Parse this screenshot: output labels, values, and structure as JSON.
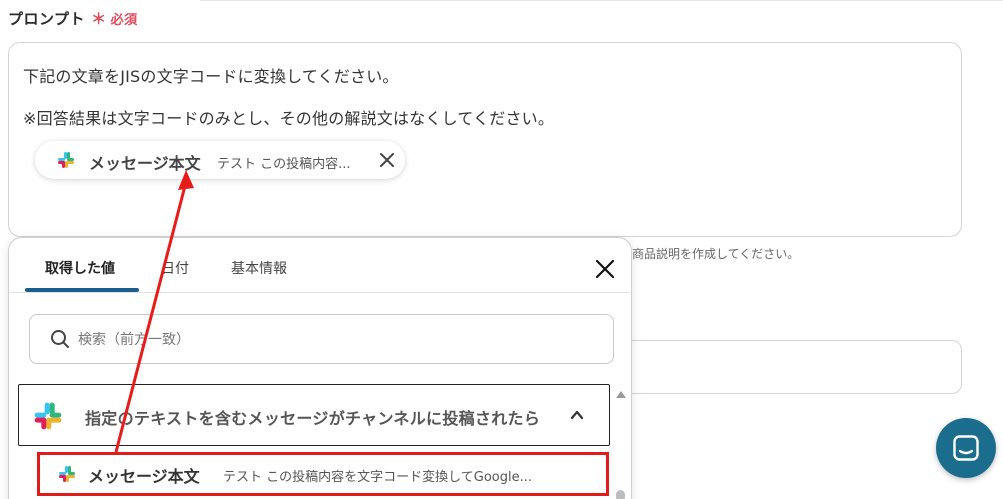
{
  "field": {
    "label": "プロンプト",
    "required_mark": "＊",
    "required_text": "必須"
  },
  "prompt": {
    "line1": "下記の文章をJISの文字コードに変換してください。",
    "line2": "※回答結果は文字コードのみとし、その他の解説文はなくしてください。",
    "chip": {
      "label": "メッセージ本文",
      "value": "テスト この投稿内容..."
    }
  },
  "helper_text": "商品説明を作成してください。",
  "popup": {
    "tabs": [
      {
        "label": "取得した値"
      },
      {
        "label": "日付"
      },
      {
        "label": "基本情報"
      }
    ],
    "search_placeholder": "検索（前方一致）",
    "group": {
      "title": "指定のテキストを含むメッセージがチャンネルに投稿されたら"
    },
    "item": {
      "label": "メッセージ本文",
      "value": "テスト この投稿内容を文字コード変換してGoogle..."
    }
  },
  "colors": {
    "accent": "#1a5d8b",
    "required": "#e14c5a",
    "highlight": "#e11a1a",
    "chat_button": "#1b6d8d"
  },
  "icons": [
    "slack-icon",
    "close-icon",
    "search-icon",
    "chevron-up-icon",
    "chat-icon"
  ]
}
